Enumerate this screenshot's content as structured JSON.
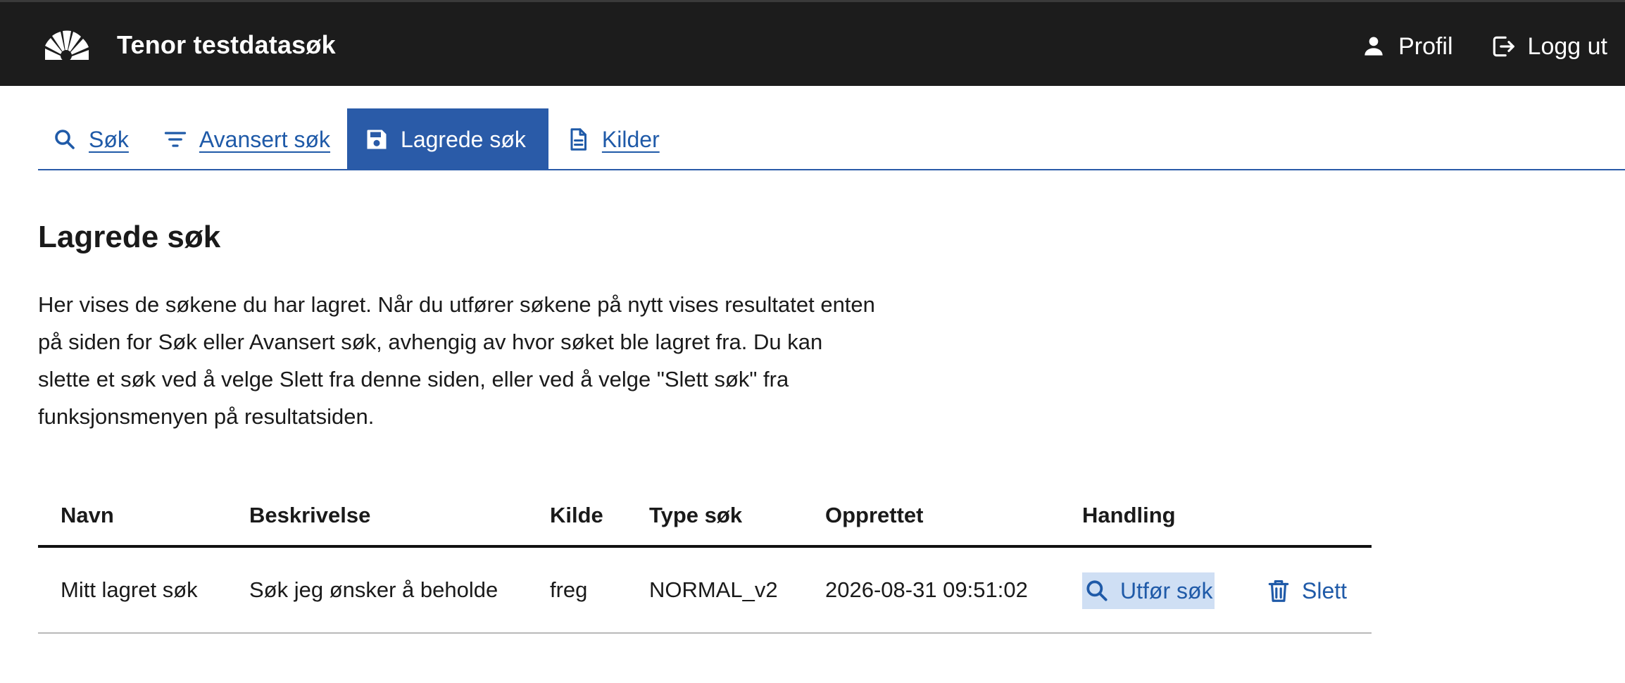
{
  "header": {
    "app_title": "Tenor testdatasøk",
    "nav": {
      "profile": "Profil",
      "logout": "Logg ut"
    }
  },
  "tabs": [
    {
      "label": "Søk",
      "icon": "search-icon",
      "active": false
    },
    {
      "label": "Avansert søk",
      "icon": "filter-icon",
      "active": false
    },
    {
      "label": "Lagrede søk",
      "icon": "save-icon",
      "active": true
    },
    {
      "label": "Kilder",
      "icon": "document-icon",
      "active": false
    }
  ],
  "main": {
    "title": "Lagrede søk",
    "intro": "Her vises de søkene du har lagret. Når du utfører søkene på nytt vises resultatet enten på siden for Søk eller Avansert søk, avhengig av hvor søket ble lagret fra. Du kan slette et søk ved å velge Slett fra denne siden, eller ved å velge \"Slett søk\" fra funksjonsmenyen på resultatsiden."
  },
  "table": {
    "columns": [
      "Navn",
      "Beskrivelse",
      "Kilde",
      "Type søk",
      "Opprettet",
      "Handling"
    ],
    "rows": [
      {
        "navn": "Mitt lagret søk",
        "beskrivelse": "Søk jeg ønsker å beholde",
        "kilde": "freg",
        "type": "NORMAL_v2",
        "opprettet": "2026-08-31 09:51:02",
        "run_label": "Utfør søk",
        "delete_label": "Slett"
      }
    ]
  },
  "colors": {
    "header_bg": "#1c1c1c",
    "accent": "#2a5ba8",
    "link": "#1f5aa8",
    "selection": "#cfdff4"
  }
}
